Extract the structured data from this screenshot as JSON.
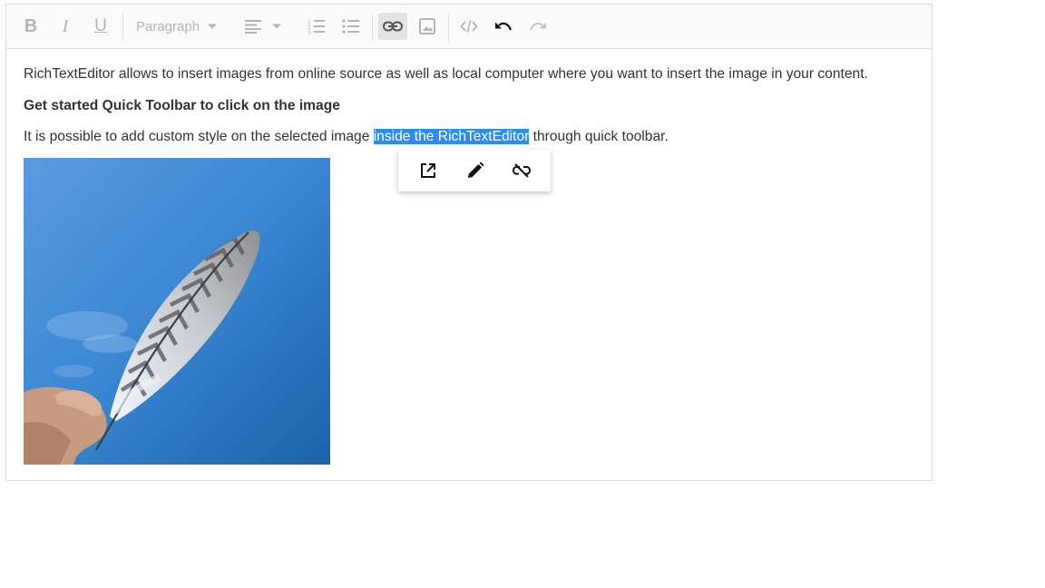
{
  "toolbar": {
    "bold": "B",
    "italic": "I",
    "underline": "U",
    "format": "Paragraph",
    "icons": [
      "bold-icon",
      "italic-icon",
      "underline-icon",
      "chevron-down-icon",
      "align-left-icon",
      "ordered-list-icon",
      "unordered-list-icon",
      "link-icon",
      "image-icon",
      "source-code-icon",
      "undo-icon",
      "redo-icon"
    ]
  },
  "content": {
    "paragraph1": "RichTextEditor allows to insert images from online source as well as local computer where you want to insert the image in your content.",
    "heading": "Get started Quick Toolbar to click on the image",
    "paragraph3_before": "It is possible to add custom style on the selected image ",
    "paragraph3_selected": "inside the RichTextEditor",
    "paragraph3_after": " through quick toolbar."
  },
  "quick_toolbar": {
    "icons": [
      "open-link-icon",
      "edit-link-icon",
      "remove-link-icon"
    ]
  },
  "colors": {
    "selection": "#2d8cf0",
    "toolbar_bg": "#fafafa",
    "border": "#dcdcdc",
    "sky": "#3f86cf"
  }
}
